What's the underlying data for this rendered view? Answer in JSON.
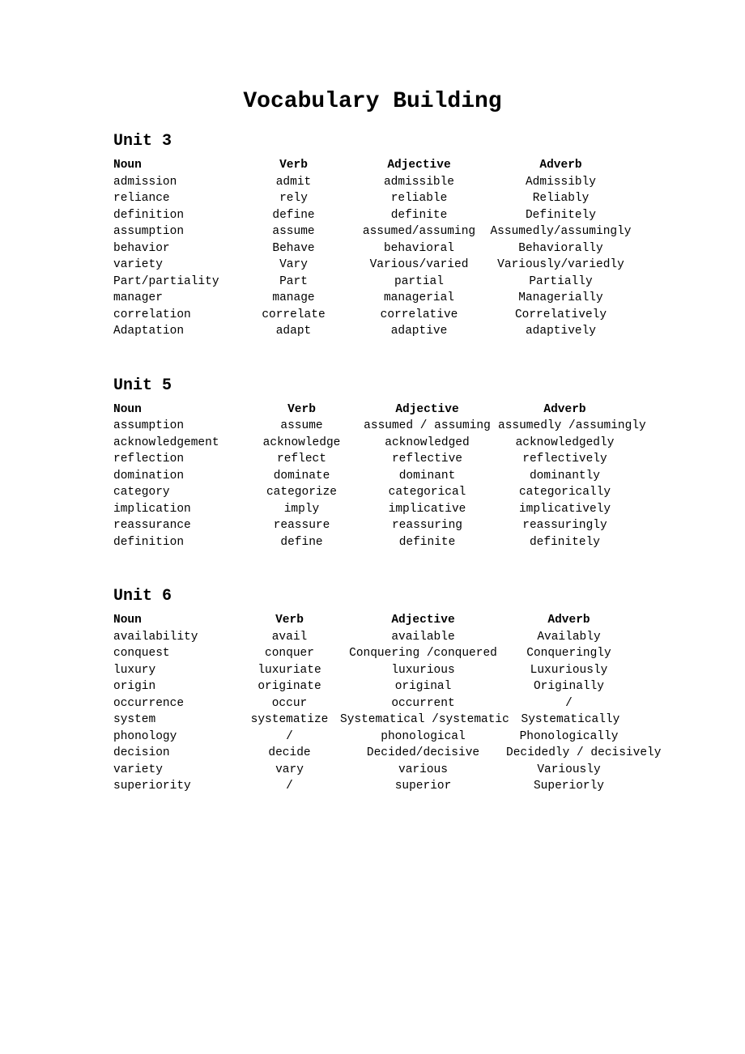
{
  "title": "Vocabulary Building",
  "columns": {
    "noun": "Noun",
    "verb": "Verb",
    "adjective": "Adjective",
    "adverb": "Adverb"
  },
  "units": [
    {
      "name": "Unit 3",
      "rows": [
        {
          "noun": "admission",
          "verb": "admit",
          "adj": "admissible",
          "adv": "Admissibly"
        },
        {
          "noun": "reliance",
          "verb": "rely",
          "adj": "reliable",
          "adv": "Reliably"
        },
        {
          "noun": "definition",
          "verb": "define",
          "adj": "definite",
          "adv": "Definitely"
        },
        {
          "noun": "assumption",
          "verb": "assume",
          "adj": "assumed/assuming",
          "adv": "Assumedly/assumingly"
        },
        {
          "noun": "behavior",
          "verb": "Behave",
          "adj": "behavioral",
          "adv": "Behaviorally"
        },
        {
          "noun": "variety",
          "verb": "Vary",
          "adj": "Various/varied",
          "adv": "Variously/variedly"
        },
        {
          "noun": "Part/partiality",
          "verb": "Part",
          "adj": "partial",
          "adv": "Partially"
        },
        {
          "noun": "manager",
          "verb": "manage",
          "adj": "managerial",
          "adv": "Managerially"
        },
        {
          "noun": "correlation",
          "verb": "correlate",
          "adj": "correlative",
          "adv": "Correlatively"
        },
        {
          "noun": "Adaptation",
          "verb": "adapt",
          "adj": "adaptive",
          "adv": "adaptively"
        }
      ]
    },
    {
      "name": "Unit 5",
      "rows": [
        {
          "noun": "assumption",
          "verb": "assume",
          "adj": "assumed / assuming",
          "adv": "assumedly /assumingly"
        },
        {
          "noun": "acknowledgement",
          "verb": "acknowledge",
          "adj": "acknowledged",
          "adv": "acknowledgedly"
        },
        {
          "noun": "reflection",
          "verb": "reflect",
          "adj": "reflective",
          "adv": "reflectively"
        },
        {
          "noun": "domination",
          "verb": "dominate",
          "adj": "dominant",
          "adv": "dominantly"
        },
        {
          "noun": "category",
          "verb": "categorize",
          "adj": "categorical",
          "adv": "categorically"
        },
        {
          "noun": "implication",
          "verb": "imply",
          "adj": "implicative",
          "adv": "implicatively"
        },
        {
          "noun": "reassurance",
          "verb": "reassure",
          "adj": "reassuring",
          "adv": "reassuringly"
        },
        {
          "noun": "definition",
          "verb": "define",
          "adj": "definite",
          "adv": "definitely"
        }
      ]
    },
    {
      "name": "Unit 6",
      "rows": [
        {
          "noun": "availability",
          "verb": "avail",
          "adj": "available",
          "adv": "Availably"
        },
        {
          "noun": "conquest",
          "verb": "conquer",
          "adj": "Conquering /conquered",
          "adv": "Conqueringly"
        },
        {
          "noun": "luxury",
          "verb": "luxuriate",
          "adj": "luxurious",
          "adv": "Luxuriously"
        },
        {
          "noun": "origin",
          "verb": "originate",
          "adj": "original",
          "adv": "Originally"
        },
        {
          "noun": "occurrence",
          "verb": "occur",
          "adj": "occurrent",
          "adv": "/"
        },
        {
          "noun": "system",
          "verb": "systematize",
          "adj": "Systematical /systematic",
          "adv": "Systematically"
        },
        {
          "noun": "phonology",
          "verb": "/",
          "adj": "phonological",
          "adv": "Phonologically"
        },
        {
          "noun": "decision",
          "verb": "decide",
          "adj": "Decided/decisive",
          "adv": "Decidedly / decisively"
        },
        {
          "noun": "variety",
          "verb": "vary",
          "adj": "various",
          "adv": "Variously"
        },
        {
          "noun": "superiority",
          "verb": "/",
          "adj": "superior",
          "adv": "Superiorly"
        }
      ]
    }
  ]
}
